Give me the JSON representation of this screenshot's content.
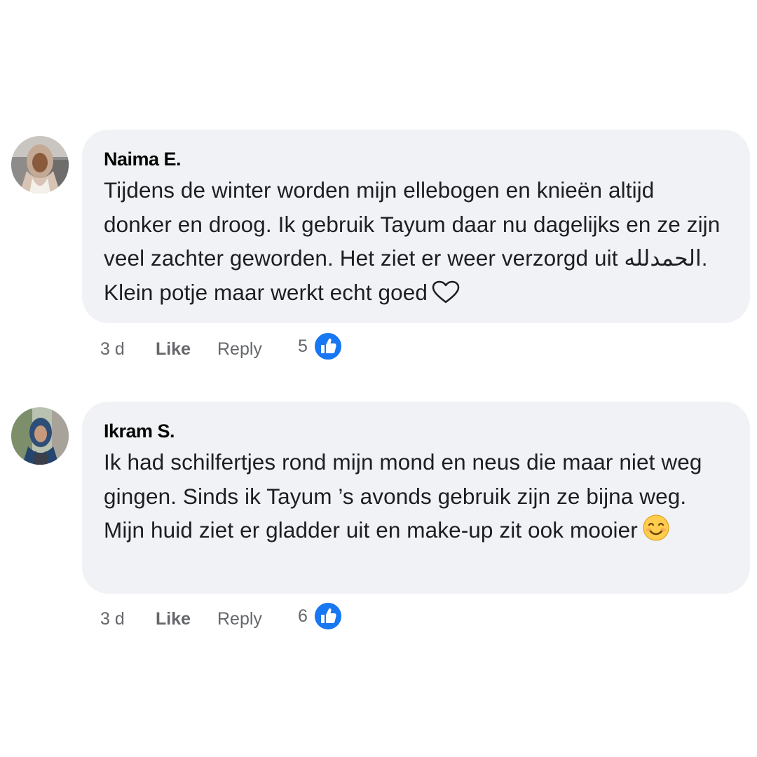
{
  "comments": [
    {
      "author": "Naima E.",
      "text": "Tijdens de winter worden mijn ellebogen en knieën altijd donker en droog. Ik gebruik Tayum daar nu dagelijks en ze zijn veel zachter geworden. Het ziet er weer verzorgd uit الحمدلله. Klein potje maar werkt echt goed",
      "trailing_icon": "heart-outline-icon",
      "time": "3 d",
      "like_label": "Like",
      "reply_label": "Reply",
      "reaction_count": "5",
      "reaction_icon": "thumbs-up-icon"
    },
    {
      "author": "Ikram S.",
      "text": "Ik had schilfertjes rond mijn mond en neus die maar niet weg gingen. Sinds ik Tayum ’s avonds gebruik zijn ze bijna weg. Mijn huid ziet er gladder uit en make-up zit ook mooier",
      "trailing_icon": "smiling-face-emoji",
      "time": "3 d",
      "like_label": "Like",
      "reply_label": "Reply",
      "reaction_count": "6",
      "reaction_icon": "thumbs-up-icon"
    }
  ],
  "colors": {
    "bubble": "#f0f2f5",
    "like_badge": "#1877f2",
    "meta_text": "#65676b"
  }
}
